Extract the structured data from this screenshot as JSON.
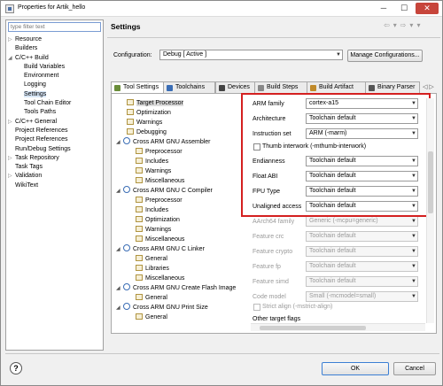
{
  "window": {
    "title": "Properties for Artik_hello",
    "minimize": "─",
    "maximize": "☐",
    "close": "✕"
  },
  "left_pane": {
    "filter_placeholder": "type filter text",
    "items": [
      {
        "label": "Resource",
        "arrow": "▷",
        "indent": 0
      },
      {
        "label": "Builders",
        "arrow": "",
        "indent": 0
      },
      {
        "label": "C/C++ Build",
        "arrow": "◢",
        "indent": 0
      },
      {
        "label": "Build Variables",
        "arrow": "",
        "indent": 1
      },
      {
        "label": "Environment",
        "arrow": "",
        "indent": 1
      },
      {
        "label": "Logging",
        "arrow": "",
        "indent": 1
      },
      {
        "label": "Settings",
        "arrow": "",
        "indent": 1
      },
      {
        "label": "Tool Chain Editor",
        "arrow": "",
        "indent": 1
      },
      {
        "label": "Tools Paths",
        "arrow": "",
        "indent": 1
      },
      {
        "label": "C/C++ General",
        "arrow": "▷",
        "indent": 0
      },
      {
        "label": "Project References",
        "arrow": "",
        "indent": 0
      },
      {
        "label": "Project References",
        "arrow": "",
        "indent": 0
      },
      {
        "label": "Run/Debug Settings",
        "arrow": "",
        "indent": 0
      },
      {
        "label": "Task Repository",
        "arrow": "▷",
        "indent": 0
      },
      {
        "label": "Task Tags",
        "arrow": "",
        "indent": 0
      },
      {
        "label": "Validation",
        "arrow": "▷",
        "indent": 0
      },
      {
        "label": "WikiText",
        "arrow": "",
        "indent": 0
      }
    ],
    "selected_index": 6
  },
  "header": {
    "title": "Settings",
    "nav_icons": [
      "⇦",
      "▾",
      "⇨",
      "▾",
      "▾"
    ]
  },
  "configuration": {
    "label": "Configuration:",
    "value": "Debug  [ Active ]",
    "manage_button": "Manage Configurations..."
  },
  "tabs": [
    {
      "label": "Tool Settings",
      "color": "#6a8d3a",
      "active": true
    },
    {
      "label": "Toolchains",
      "color": "#3a6db5",
      "active": false
    },
    {
      "label": "Devices",
      "color": "#444444",
      "active": false
    },
    {
      "label": "Build Steps",
      "color": "#888888",
      "active": false
    },
    {
      "label": "Build Artifact",
      "color": "#c08a2a",
      "active": false
    },
    {
      "label": "Binary Parser",
      "color": "#555555",
      "active": false
    }
  ],
  "tabs_more": "◁ ▷",
  "tool_tree": [
    {
      "label": "Target Processor",
      "type": "leaf",
      "indent": 1,
      "selected": true
    },
    {
      "label": "Optimization",
      "type": "leaf",
      "indent": 1
    },
    {
      "label": "Warnings",
      "type": "leaf",
      "indent": 1
    },
    {
      "label": "Debugging",
      "type": "leaf",
      "indent": 1
    },
    {
      "label": "Cross ARM GNU Assembler",
      "type": "tool",
      "indent": 0
    },
    {
      "label": "Preprocessor",
      "type": "leaf",
      "indent": 2
    },
    {
      "label": "Includes",
      "type": "leaf",
      "indent": 2
    },
    {
      "label": "Warnings",
      "type": "leaf",
      "indent": 2
    },
    {
      "label": "Miscellaneous",
      "type": "leaf",
      "indent": 2
    },
    {
      "label": "Cross ARM GNU C Compiler",
      "type": "tool",
      "indent": 0
    },
    {
      "label": "Preprocessor",
      "type": "leaf",
      "indent": 2
    },
    {
      "label": "Includes",
      "type": "leaf",
      "indent": 2
    },
    {
      "label": "Optimization",
      "type": "leaf",
      "indent": 2
    },
    {
      "label": "Warnings",
      "type": "leaf",
      "indent": 2
    },
    {
      "label": "Miscellaneous",
      "type": "leaf",
      "indent": 2
    },
    {
      "label": "Cross ARM GNU C Linker",
      "type": "tool",
      "indent": 0
    },
    {
      "label": "General",
      "type": "leaf",
      "indent": 2
    },
    {
      "label": "Libraries",
      "type": "leaf",
      "indent": 2
    },
    {
      "label": "Miscellaneous",
      "type": "leaf",
      "indent": 2
    },
    {
      "label": "Cross ARM GNU Create Flash Image",
      "type": "tool",
      "indent": 0
    },
    {
      "label": "General",
      "type": "leaf",
      "indent": 2
    },
    {
      "label": "Cross ARM GNU Print Size",
      "type": "tool",
      "indent": 0
    },
    {
      "label": "General",
      "type": "leaf",
      "indent": 2
    }
  ],
  "form": {
    "arm_family": {
      "label": "ARM family",
      "value": "cortex-a15"
    },
    "architecture": {
      "label": "Architecture",
      "value": "Toolchain default"
    },
    "instruction_set": {
      "label": "Instruction set",
      "value": "ARM (-marm)"
    },
    "thumb_interwork": {
      "label": "Thumb interwork (-mthumb-interwork)"
    },
    "endianness": {
      "label": "Endianness",
      "value": "Toolchain default"
    },
    "float_abi": {
      "label": "Float ABI",
      "value": "Toolchain default"
    },
    "fpu_type": {
      "label": "FPU Type",
      "value": "Toolchain default"
    },
    "unaligned_access": {
      "label": "Unaligned access",
      "value": "Toolchain default"
    },
    "aarch64_family": {
      "label": "AArch64 family",
      "value": "Generic (-mcpu=generic)"
    },
    "feature_crc": {
      "label": "Feature crc",
      "value": "Toolchain default"
    },
    "feature_crypto": {
      "label": "Feature crypto",
      "value": "Toolchain default"
    },
    "feature_fp": {
      "label": "Feature fp",
      "value": "Toolchain default"
    },
    "feature_simd": {
      "label": "Feature simd",
      "value": "Toolchain default"
    },
    "code_model": {
      "label": "Code model",
      "value": "Small (-mcmodel=small)"
    },
    "strict_align": {
      "label": "Strict align (-mstrict-align)"
    },
    "other_target_flags": {
      "label": "Other target flags",
      "value": ""
    }
  },
  "footer": {
    "help": "?",
    "ok": "OK",
    "cancel": "Cancel"
  }
}
